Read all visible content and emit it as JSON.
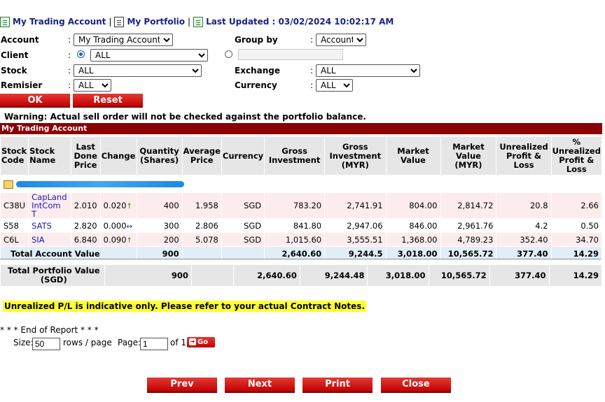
{
  "nav": {
    "my_trading_account": "My Trading Account",
    "my_portfolio": "My Portfolio",
    "last_updated": "Last Updated : 03/02/2024 10:02:17 AM",
    "separator": "|"
  },
  "filters": {
    "account_label": "Account",
    "account_value": "My Trading Account",
    "client_label": "Client",
    "client_value": "ALL",
    "stock_label": "Stock",
    "stock_value": "ALL",
    "remisier_label": "Remisier",
    "remisier_value": "ALL",
    "group_by_label": "Group by",
    "group_by_value": "Account",
    "exchange_label": "Exchange",
    "exchange_value": "ALL",
    "currency_label": "Currency",
    "currency_value": "ALL",
    "colon": ":"
  },
  "buttons": {
    "ok": "OK",
    "reset": "Reset",
    "prev": "Prev",
    "next": "Next",
    "print": "Print",
    "close": "Close",
    "go": "Go"
  },
  "warning": "Warning: Actual sell order will not be checked against the portfolio balance.",
  "section_title": "My Trading Account",
  "table": {
    "headers": [
      "Stock Code",
      "Stock Name",
      "Last Done Price",
      "Change",
      "Quantity (Shares)",
      "Average Price",
      "Currency",
      "Gross Investment",
      "Gross Investment (MYR)",
      "Market Value",
      "Market Value (MYR)",
      "Unrealized Profit & Loss",
      "% Unrealized Profit & Loss"
    ],
    "rows": [
      {
        "code": "C38U",
        "name": "CapLand IntCom T",
        "last": "2.010",
        "change": "0.020",
        "arrow": "↑",
        "qty": "400",
        "avg": "1.958",
        "cur": "SGD",
        "gross": "783.20",
        "gross_myr": "2,741.91",
        "mv": "804.00",
        "mv_myr": "2,814.72",
        "upl": "20.8",
        "pct": "2.66"
      },
      {
        "code": "S58",
        "name": "SATS",
        "last": "2.820",
        "change": "0.000",
        "arrow": "↔",
        "qty": "300",
        "avg": "2.806",
        "cur": "SGD",
        "gross": "841.80",
        "gross_myr": "2,947.06",
        "mv": "846.00",
        "mv_myr": "2,961.76",
        "upl": "4.2",
        "pct": "0.50"
      },
      {
        "code": "C6L",
        "name": "SIA",
        "last": "6.840",
        "change": "0.090",
        "arrow": "↑",
        "qty": "200",
        "avg": "5.078",
        "cur": "SGD",
        "gross": "1,015.60",
        "gross_myr": "3,555.51",
        "mv": "1,368.00",
        "mv_myr": "4,789.23",
        "upl": "352.40",
        "pct": "34.70"
      }
    ],
    "total": {
      "label": "Total Account Value",
      "qty": "900",
      "gross": "2,640.60",
      "gross_myr": "9,244.5",
      "mv": "3,018.00",
      "mv_myr": "10,565.72",
      "upl": "377.40",
      "pct": "14.29"
    }
  },
  "portfolio": {
    "label": "Total Portfolio Value (SGD)",
    "qty": "900",
    "gross": "2,640.60",
    "gross_myr": "9,244.48",
    "mv": "3,018.00",
    "mv_myr": "10,565.72",
    "upl": "377.40",
    "pct": "14.29"
  },
  "note": "Unrealized P/L is indicative only. Please refer to your actual Contract Notes.",
  "end_of_report": "* * * End of Report * * *",
  "pager": {
    "size_label": "Size:",
    "size_value": "50",
    "rows_label": "rows / page",
    "page_label": "Page:",
    "page_value": "1",
    "of_label": "of 1"
  },
  "colors": {
    "brand_red": "#c00000",
    "section_bar": "#8b0000",
    "nav_blue": "#1a237e",
    "highlight_yellow": "#ffff33"
  }
}
